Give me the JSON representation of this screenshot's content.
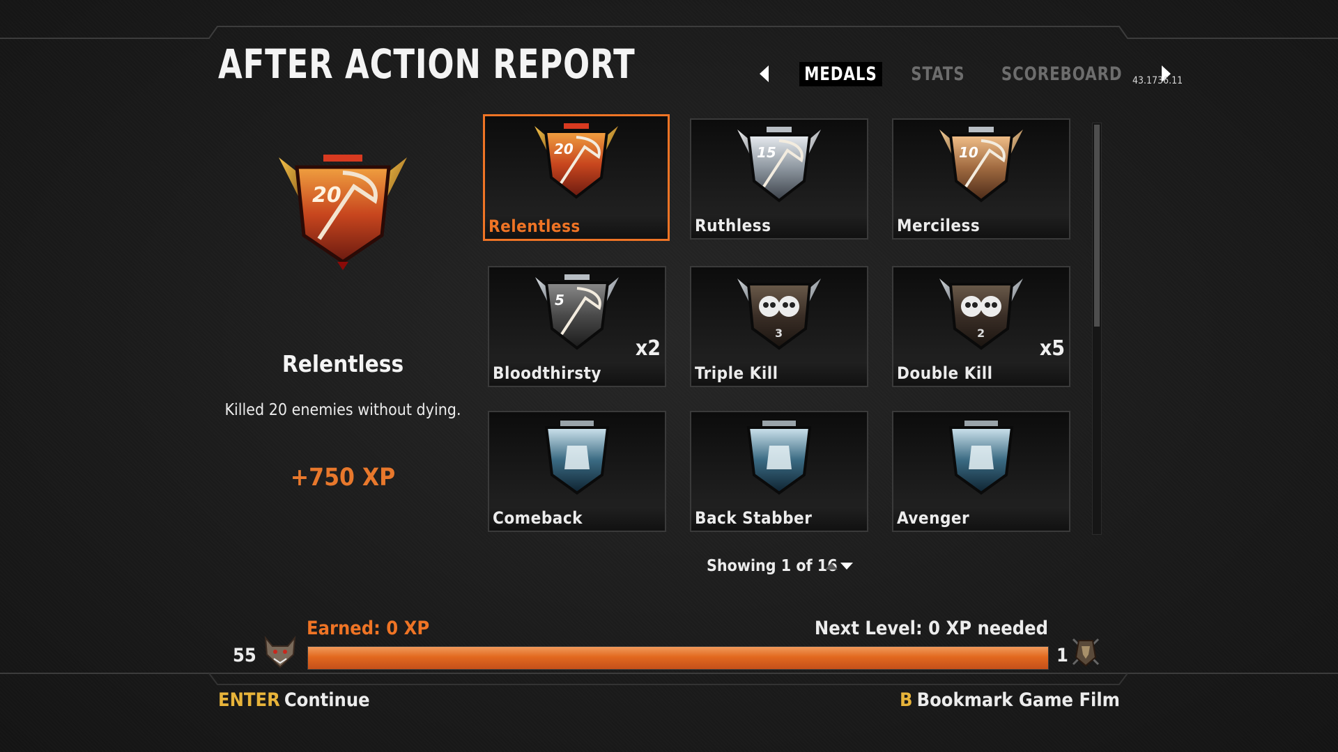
{
  "header": {
    "title": "AFTER ACTION REPORT",
    "tabs": [
      {
        "label": "MEDALS",
        "active": true
      },
      {
        "label": "STATS",
        "active": false
      },
      {
        "label": "SCOREBOARD",
        "active": false
      }
    ],
    "build_version": "43.1736.11"
  },
  "detail": {
    "medal_icon": "relentless-medal-icon",
    "medal_number": "20",
    "name": "Relentless",
    "description": "Killed 20 enemies without dying.",
    "xp": "+750 XP"
  },
  "medals": [
    {
      "name": "Relentless",
      "count": "",
      "icon": "relentless-medal-icon",
      "number": "20",
      "style": "gold",
      "selected": true
    },
    {
      "name": "Ruthless",
      "count": "",
      "icon": "ruthless-medal-icon",
      "number": "15",
      "style": "silver",
      "selected": false
    },
    {
      "name": "Merciless",
      "count": "",
      "icon": "merciless-medal-icon",
      "number": "10",
      "style": "bronze",
      "selected": false
    },
    {
      "name": "Bloodthirsty",
      "count": "x2",
      "icon": "bloodthirsty-medal-icon",
      "number": "5",
      "style": "dark",
      "selected": false
    },
    {
      "name": "Triple Kill",
      "count": "",
      "icon": "triple-kill-medal-icon",
      "number": "3",
      "style": "skull",
      "selected": false
    },
    {
      "name": "Double Kill",
      "count": "x5",
      "icon": "double-kill-medal-icon",
      "number": "2",
      "style": "skull",
      "selected": false
    },
    {
      "name": "Comeback",
      "count": "",
      "icon": "comeback-medal-icon",
      "number": "",
      "style": "blue",
      "selected": false
    },
    {
      "name": "Back Stabber",
      "count": "",
      "icon": "back-stabber-medal-icon",
      "number": "",
      "style": "blue",
      "selected": false
    },
    {
      "name": "Avenger",
      "count": "",
      "icon": "avenger-medal-icon",
      "number": "",
      "style": "blue",
      "selected": false
    }
  ],
  "pagination": {
    "text": "Showing 1 of 16"
  },
  "progress": {
    "current_level": "55",
    "next_level": "1",
    "earned": "Earned: 0 XP",
    "next_text": "Next Level: 0 XP needed",
    "fill_fraction": 1.0
  },
  "prompts": {
    "continue_key": "ENTER",
    "continue_label": "Continue",
    "bookmark_key": "B",
    "bookmark_label": "Bookmark Game Film"
  },
  "colors": {
    "accent_orange": "#ef7425",
    "key_yellow": "#e8b43a",
    "tab_inactive": "#6d6d6d"
  }
}
